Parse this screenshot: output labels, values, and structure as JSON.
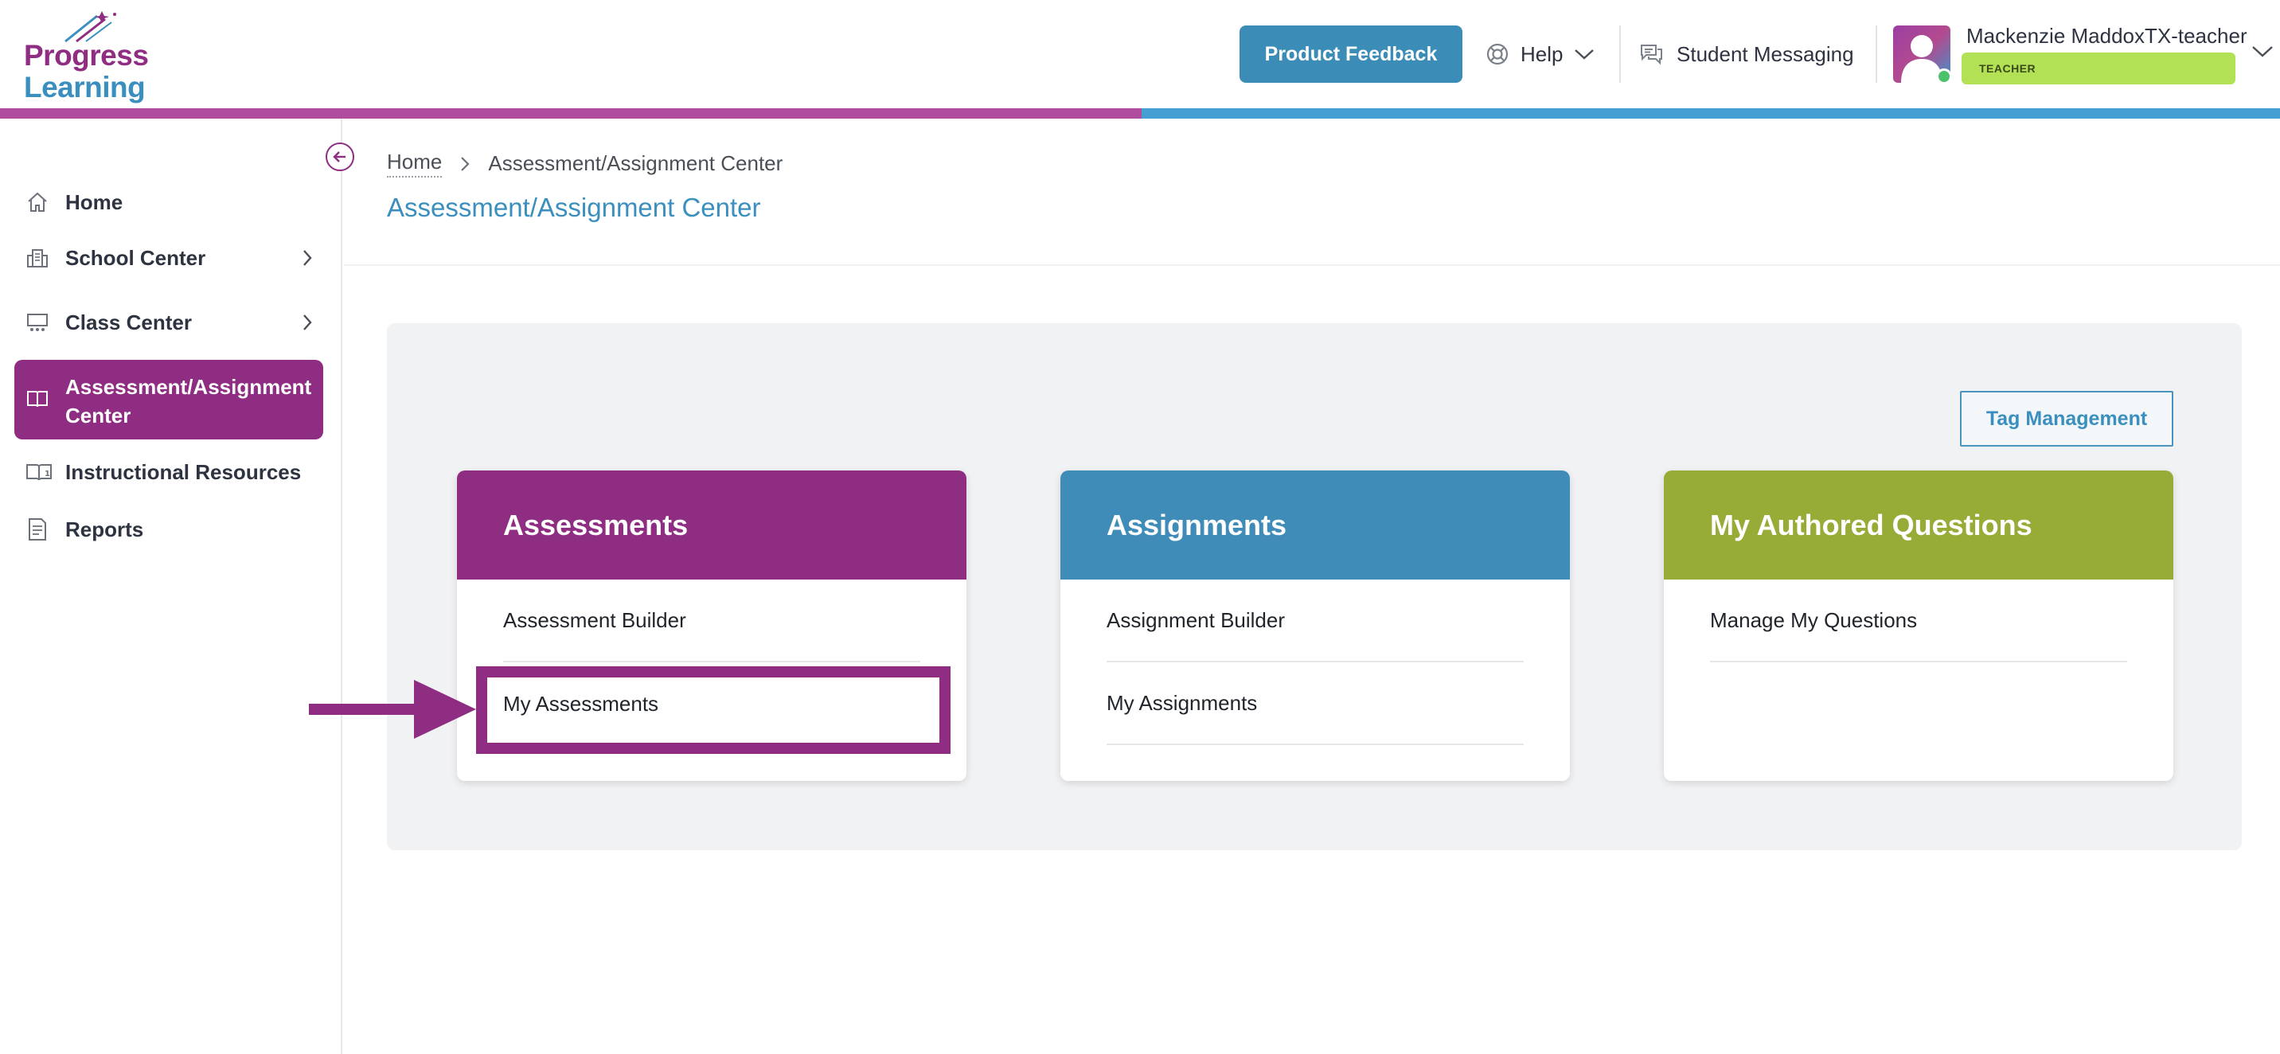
{
  "brand": {
    "line1": "Progress",
    "line2": "Learning",
    "purple": "#8e2d82",
    "blue": "#3a8fbf"
  },
  "header": {
    "feedback_label": "Product Feedback",
    "help_label": "Help",
    "messaging_label": "Student Messaging",
    "user_name": "Mackenzie MaddoxTX-teacher",
    "role": "TEACHER"
  },
  "sidebar": {
    "items": [
      {
        "label": "Home",
        "icon": "home-icon"
      },
      {
        "label": "School Center",
        "icon": "building-icon"
      },
      {
        "label": "Class Center",
        "icon": "classroom-icon"
      },
      {
        "label": "Assessment/Assignment",
        "label2": "Center",
        "icon": "book-icon",
        "active": true
      },
      {
        "label": "Instructional Resources",
        "icon": "resources-icon"
      },
      {
        "label": "Reports",
        "icon": "report-icon"
      }
    ]
  },
  "breadcrumb": {
    "home": "Home",
    "current": "Assessment/Assignment Center"
  },
  "page_title": "Assessment/Assignment Center",
  "tag_management_label": "Tag Management",
  "cards": [
    {
      "title": "Assessments",
      "color": "#8e2d82",
      "links": [
        "Assessment Builder",
        "My Assessments"
      ]
    },
    {
      "title": "Assignments",
      "color": "#3f8cb8",
      "links": [
        "Assignment Builder",
        "My Assignments"
      ]
    },
    {
      "title": "My Authored Questions",
      "color": "#97ab37",
      "links": [
        "Manage My Questions"
      ]
    }
  ],
  "annotation_color": "#8e2d82"
}
